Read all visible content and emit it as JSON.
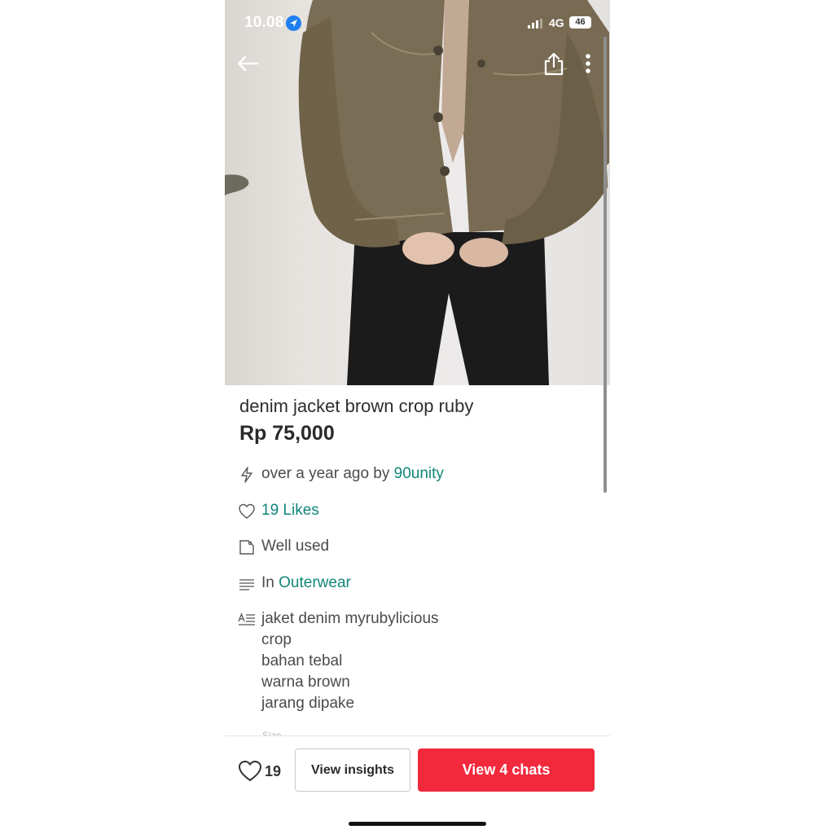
{
  "status_bar": {
    "time": "10.08",
    "network": "4G",
    "battery": "46"
  },
  "icons": {
    "back": "arrow-left-icon",
    "share": "share-icon",
    "more": "more-vertical-icon",
    "location": "location-arrow-icon",
    "signal": "signal-bars-icon",
    "posted": "lightning-icon",
    "likes": "heart-outline-icon",
    "condition": "tag-icon",
    "category": "list-lines-icon",
    "description": "text-description-icon"
  },
  "product": {
    "title": "denim jacket brown crop ruby",
    "price": "Rp 75,000"
  },
  "details": {
    "posted_prefix": "over a year ago by",
    "seller": "90unity",
    "likes": "19 Likes",
    "condition": "Well used",
    "category_prefix": "In",
    "category": "Outerwear",
    "description_lines": [
      "jaket denim myrubylicious",
      "crop",
      "bahan tebal",
      "warna brown",
      "jarang dipake"
    ],
    "size_label": "Size"
  },
  "bottom_bar": {
    "like_count": "19",
    "insights_label": "View insights",
    "chats_label": "View 4 chats"
  },
  "colors": {
    "accent_link": "#11867a",
    "primary_button": "#f2293d"
  }
}
